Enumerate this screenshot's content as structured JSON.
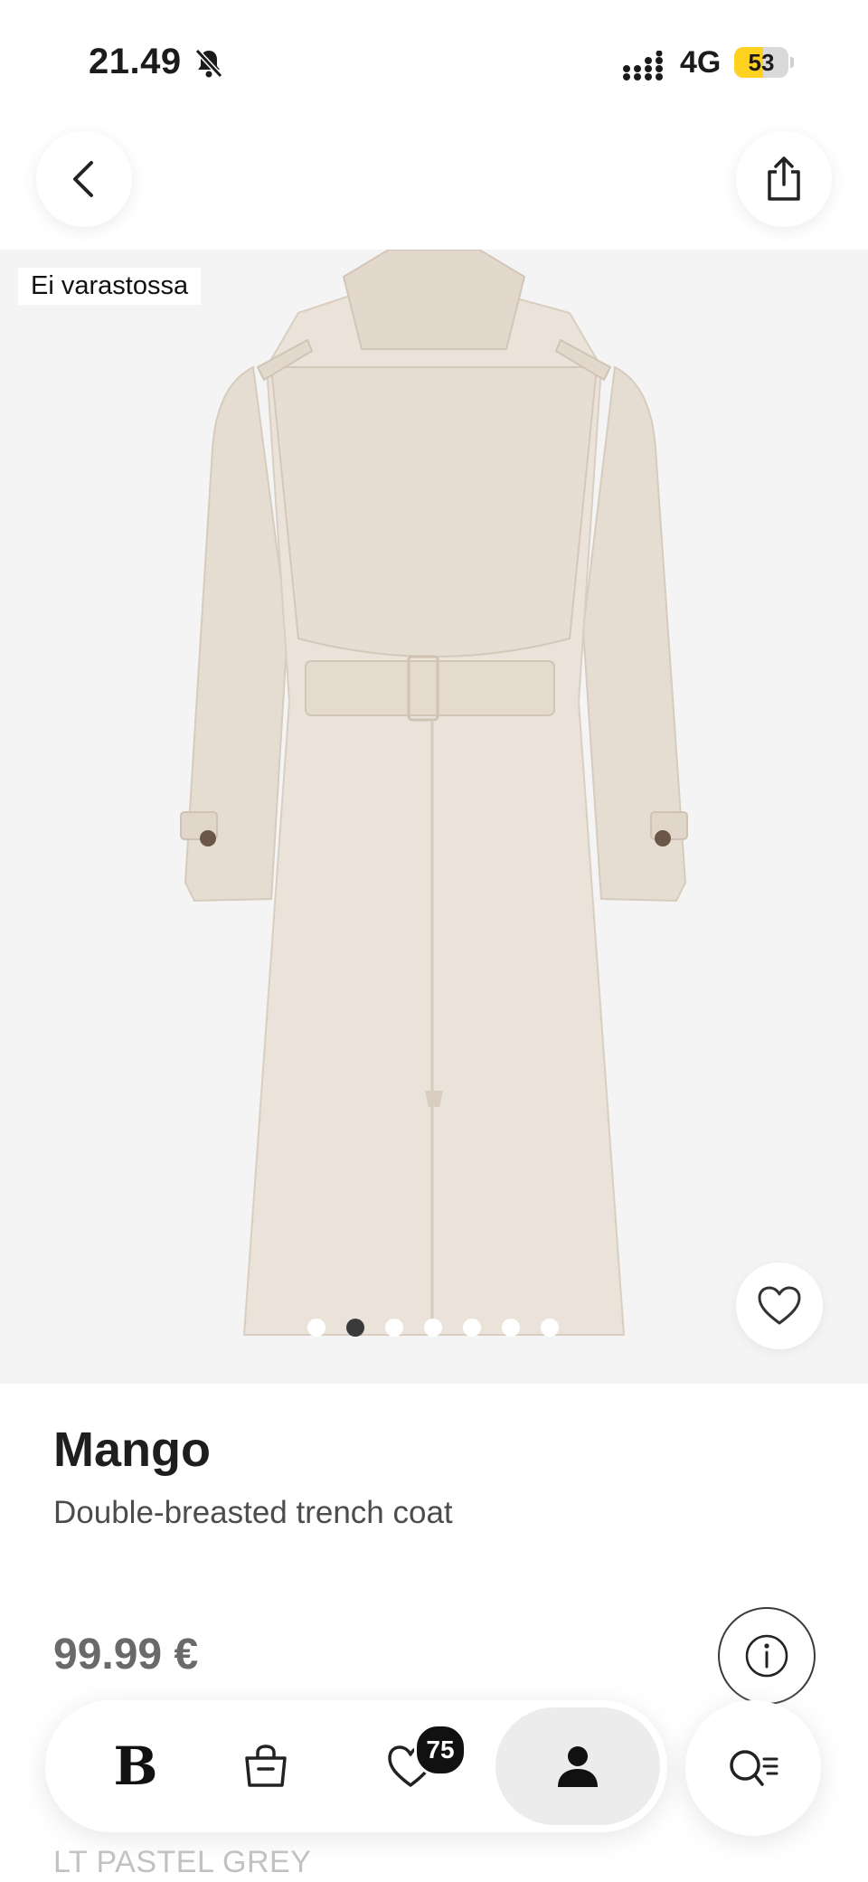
{
  "status_bar": {
    "time": "21.49",
    "network": "4G",
    "battery_level": "53",
    "battery_fraction": 0.53
  },
  "product": {
    "stock_status": "Ei varastossa",
    "brand": "Mango",
    "name": "Double-breasted trench coat",
    "price": "99.99 €",
    "color": "LT PASTEL GREY",
    "image_count": 7,
    "active_image_index": 1
  },
  "bottom_nav": {
    "brand_logo": "B",
    "wishlist_count": "75",
    "active_item": "profile"
  },
  "icons": {
    "back": "chevron-left-icon",
    "share": "share-icon",
    "favorite": "heart-icon",
    "info": "info-icon",
    "bag": "shopping-bag-icon",
    "profile": "person-icon",
    "search": "search-filter-icon",
    "mute": "bell-slash-icon"
  },
  "colors": {
    "battery_fill": "#ffd21f",
    "image_background": "#f4f4f4",
    "coat": "#e9e0d6"
  }
}
